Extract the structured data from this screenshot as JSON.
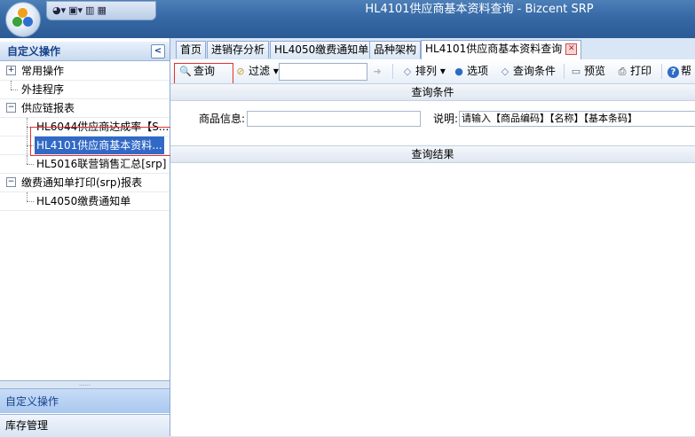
{
  "window": {
    "title": "HL4101供应商基本资料查询 - Bizcent SRP"
  },
  "colors": {
    "title_bar": "#3669a5",
    "selected": "#3169c6",
    "highlight_box": "#e53030",
    "accent": "#15428b"
  },
  "quick_access": {
    "icons": [
      "palette-icon",
      "window-icon",
      "save-icon",
      "calculator-icon"
    ],
    "glyphs": [
      "◕▾",
      "▣▾",
      "▥",
      "▦"
    ]
  },
  "left_panel": {
    "title": "自定义操作",
    "collapse_glyph": "<",
    "tree": [
      {
        "label": "常用操作",
        "exp": "+"
      },
      {
        "label": "外挂程序"
      },
      {
        "label": "供应链报表",
        "exp": "−"
      },
      {
        "label": "HL6044供应商达成率【S..."
      },
      {
        "label": "HL4101供应商基本资料..."
      },
      {
        "label": "HL5016联营销售汇总[srp]"
      },
      {
        "label": "缴费通知单打印(srp)报表",
        "exp": "−"
      },
      {
        "label": "HL4050缴费通知单"
      }
    ],
    "splitter_glyph": "......",
    "sections": [
      "自定义操作",
      "库存管理"
    ]
  },
  "tabs": [
    {
      "label": "首页"
    },
    {
      "label": "进销存分析"
    },
    {
      "label": "HL4050缴费通知单"
    },
    {
      "label": "品种架构"
    },
    {
      "label": "HL4101供应商基本资料查询",
      "close": "✕"
    }
  ],
  "toolbar": {
    "query": "查询",
    "filter": "过滤 ▾",
    "sort": "排列 ▾",
    "options": "选项",
    "conditions": "查询条件",
    "preview": "预览",
    "print": "打印",
    "help": "帮",
    "glyphs": {
      "query": "🔍",
      "filter": "⊘",
      "go": "➜",
      "sort": "◇",
      "options": "●",
      "conditions": "◇",
      "preview": "▭",
      "print": "⎙",
      "help": "?"
    }
  },
  "content": {
    "conditions_header": "查询条件",
    "product_label": "商品信息:",
    "product_value": "",
    "note_label": "说明:",
    "note_value": "请输入【商品编码】【名称】【基本条码】",
    "results_header": "查询结果"
  }
}
